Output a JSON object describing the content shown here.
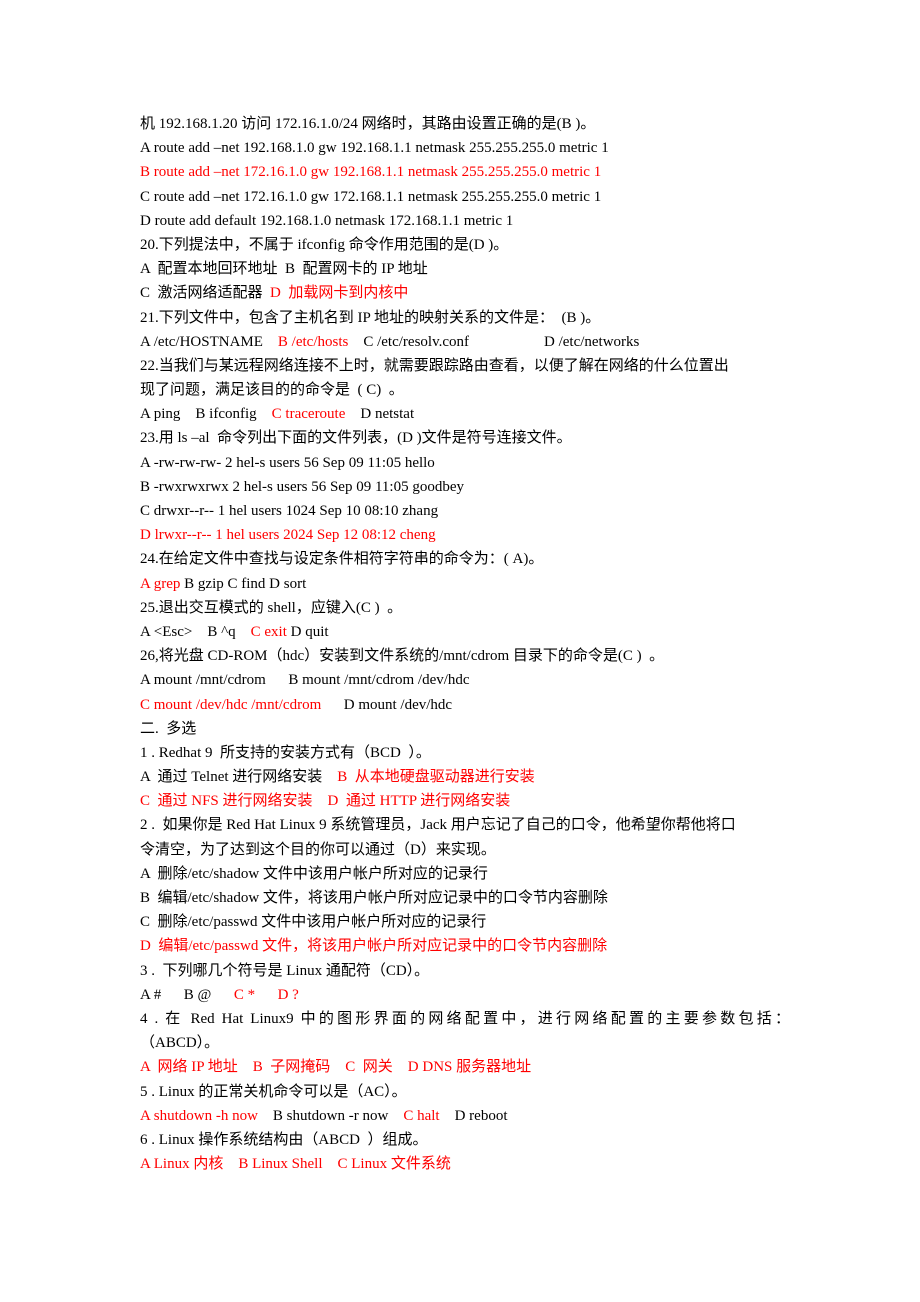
{
  "colors": {
    "text": "#000000",
    "answer": "#ff0000",
    "background": "#ffffff"
  },
  "lines": [
    [
      {
        "t": "机 192.168.1.20 访问 172.16.1.0/24 网络时，其路由设置正确的是(B )。",
        "c": "black"
      }
    ],
    [
      {
        "t": "A route add –net 192.168.1.0 gw 192.168.1.1 netmask 255.255.255.0 metric 1",
        "c": "black"
      }
    ],
    [
      {
        "t": "B route add –net 172.16.1.0 gw 192.168.1.1 netmask 255.255.255.0 metric 1",
        "c": "red"
      }
    ],
    [
      {
        "t": "C route add –net 172.16.1.0 gw 172.168.1.1 netmask 255.255.255.0 metric 1",
        "c": "black"
      }
    ],
    [
      {
        "t": "D route add default 192.168.1.0 netmask 172.168.1.1 metric 1",
        "c": "black"
      }
    ],
    [
      {
        "t": "20.下列提法中，不属于 ifconfig 命令作用范围的是(D )。",
        "c": "black"
      }
    ],
    [
      {
        "t": "A  配置本地回环地址  B  配置网卡的 IP 地址",
        "c": "black"
      }
    ],
    [
      {
        "t": "C  激活网络适配器  ",
        "c": "black"
      },
      {
        "t": "D  加载网卡到内核中",
        "c": "red"
      }
    ],
    [
      {
        "t": "21.下列文件中，包含了主机名到 IP 地址的映射关系的文件是：  (B )。",
        "c": "black"
      }
    ],
    [
      {
        "t": "A /etc/HOSTNAME    ",
        "c": "black"
      },
      {
        "t": "B /etc/hosts",
        "c": "red"
      },
      {
        "t": "    C /etc/resolv.conf                    D /etc/networks",
        "c": "black"
      }
    ],
    [
      {
        "t": "22.当我们与某远程网络连接不上时，就需要跟踪路由查看，以便了解在网络的什么位置出",
        "c": "black"
      }
    ],
    [
      {
        "t": "现了问题，满足该目的的命令是  ( C)  。",
        "c": "black"
      }
    ],
    [
      {
        "t": "A ping    B ifconfig    ",
        "c": "black"
      },
      {
        "t": "C traceroute",
        "c": "red"
      },
      {
        "t": "    D netstat",
        "c": "black"
      }
    ],
    [
      {
        "t": "23.用 ls –al  命令列出下面的文件列表，(D )文件是符号连接文件。",
        "c": "black"
      }
    ],
    [
      {
        "t": "A -rw-rw-rw- 2 hel-s users 56 Sep 09 11:05 hello",
        "c": "black"
      }
    ],
    [
      {
        "t": "B -rwxrwxrwx 2 hel-s users 56 Sep 09 11:05 goodbey",
        "c": "black"
      }
    ],
    [
      {
        "t": "C drwxr--r-- 1 hel users 1024 Sep 10 08:10 zhang",
        "c": "black"
      }
    ],
    [
      {
        "t": "D lrwxr--r-- 1 hel users 2024 Sep 12 08:12 cheng",
        "c": "red"
      }
    ],
    [
      {
        "t": "24.在给定文件中查找与设定条件相符字符串的命令为：( A)。",
        "c": "black"
      }
    ],
    [
      {
        "t": "A grep",
        "c": "red"
      },
      {
        "t": " B gzip C find D sort",
        "c": "black"
      }
    ],
    [
      {
        "t": "25.退出交互模式的 shell，应键入(C )  。",
        "c": "black"
      }
    ],
    [
      {
        "t": "A <Esc>    B ^q    ",
        "c": "black"
      },
      {
        "t": "C exit",
        "c": "red"
      },
      {
        "t": " D quit",
        "c": "black"
      }
    ],
    [
      {
        "t": "26,将光盘 CD-ROM（hdc）安装到文件系统的/mnt/cdrom 目录下的命令是(C )  。",
        "c": "black"
      }
    ],
    [
      {
        "t": "A mount /mnt/cdrom      B mount /mnt/cdrom /dev/hdc",
        "c": "black"
      }
    ],
    [
      {
        "t": "C mount /dev/hdc /mnt/cdrom",
        "c": "red"
      },
      {
        "t": "      D mount /dev/hdc",
        "c": "black"
      }
    ],
    [
      {
        "t": "二.  多选",
        "c": "black"
      }
    ],
    [
      {
        "t": "1 . Redhat 9  所支持的安装方式有（BCD  ）。",
        "c": "black"
      }
    ],
    [
      {
        "t": "A  通过 Telnet 进行网络安装    ",
        "c": "black"
      },
      {
        "t": "B  从本地硬盘驱动器进行安装",
        "c": "red"
      }
    ],
    [
      {
        "t": "C  通过 NFS 进行网络安装    D  通过 HTTP 进行网络安装",
        "c": "red"
      }
    ],
    [
      {
        "t": "2 .  如果你是 Red Hat Linux 9 系统管理员，Jack 用户忘记了自己的口令，他希望你帮他将口",
        "c": "black"
      }
    ],
    [
      {
        "t": "令清空，为了达到这个目的你可以通过（D）来实现。",
        "c": "black"
      }
    ],
    [
      {
        "t": "A  删除/etc/shadow 文件中该用户帐户所对应的记录行",
        "c": "black"
      }
    ],
    [
      {
        "t": "B  编辑/etc/shadow 文件，将该用户帐户所对应记录中的口令节内容删除",
        "c": "black"
      }
    ],
    [
      {
        "t": "C  删除/etc/passwd 文件中该用户帐户所对应的记录行",
        "c": "black"
      }
    ],
    [
      {
        "t": "D  编辑/etc/passwd 文件，将该用户帐户所对应记录中的口令节内容删除",
        "c": "red"
      }
    ],
    [
      {
        "t": "3 .  下列哪几个符号是 Linux 通配符（CD）。",
        "c": "black"
      }
    ],
    [
      {
        "t": "A #      B @      ",
        "c": "black"
      },
      {
        "t": "C *      D ?",
        "c": "red"
      }
    ],
    [
      {
        "t": "4 .  在 Red Hat Linux9 中的图形界面的网络配置中，进行网络配置的主要参数包括：",
        "c": "black",
        "justify": true
      }
    ],
    [
      {
        "t": "（ABCD）。",
        "c": "black"
      }
    ],
    [
      {
        "t": "A  网络 IP 地址    B  子网掩码    C  网关    D DNS 服务器地址",
        "c": "red"
      }
    ],
    [
      {
        "t": "5 . Linux 的正常关机命令可以是（AC）。",
        "c": "black"
      }
    ],
    [
      {
        "t": "A shutdown -h now",
        "c": "red"
      },
      {
        "t": "    B shutdown -r now    ",
        "c": "black"
      },
      {
        "t": "C halt",
        "c": "red"
      },
      {
        "t": "    D reboot",
        "c": "black"
      }
    ],
    [
      {
        "t": "6 . Linux 操作系统结构由（ABCD  ）组成。",
        "c": "black"
      }
    ],
    [
      {
        "t": "A Linux 内核    B Linux Shell    C Linux 文件系统",
        "c": "red"
      }
    ]
  ]
}
